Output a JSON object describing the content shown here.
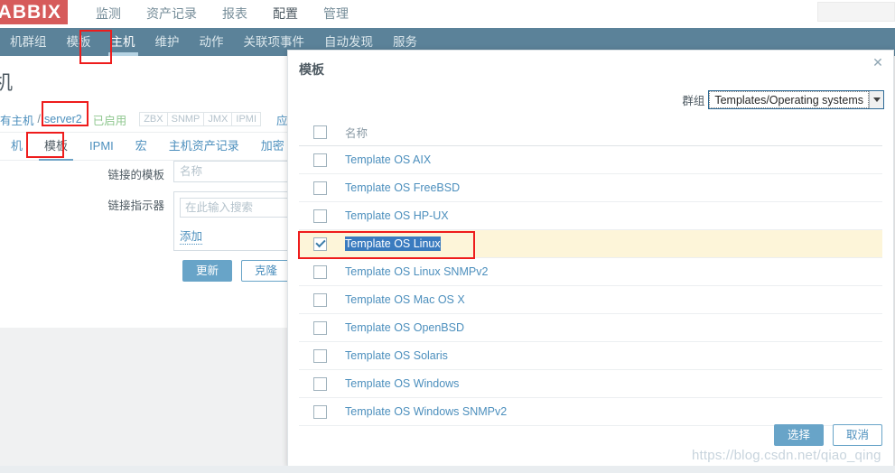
{
  "app": {
    "logo_text": "ABBIX",
    "main_menu": [
      {
        "label": "监测",
        "active": false
      },
      {
        "label": "资产记录",
        "active": false
      },
      {
        "label": "报表",
        "active": false
      },
      {
        "label": "配置",
        "active": true
      },
      {
        "label": "管理",
        "active": false
      }
    ],
    "sub_menu": [
      {
        "label": "机群组",
        "active": false
      },
      {
        "label": "模板",
        "active": false
      },
      {
        "label": "主机",
        "active": true
      },
      {
        "label": "维护",
        "active": false
      },
      {
        "label": "动作",
        "active": false
      },
      {
        "label": "关联项事件",
        "active": false
      },
      {
        "label": "自动发现",
        "active": false
      },
      {
        "label": "服务",
        "active": false
      }
    ]
  },
  "page": {
    "title": "机",
    "breadcrumb": {
      "root": "有主机",
      "separator": "/",
      "current": "server2"
    },
    "status": "已启用",
    "interface_tags": [
      "ZBX",
      "SNMP",
      "JMX",
      "IPMI"
    ],
    "apply_link": "应月",
    "tabs": [
      {
        "label": "机",
        "active": false
      },
      {
        "label": "模板",
        "active": true
      },
      {
        "label": "IPMI",
        "active": false
      },
      {
        "label": "宏",
        "active": false
      },
      {
        "label": "主机资产记录",
        "active": false
      },
      {
        "label": "加密",
        "active": false
      }
    ],
    "form": {
      "linked_templates_label": "链接的模板",
      "linked_templates_placeholder": "名称",
      "link_indicator_label": "链接指示器",
      "link_indicator_placeholder": "在此输入搜索",
      "add_link": "添加",
      "buttons": [
        {
          "label": "更新",
          "style": "primary"
        },
        {
          "label": "克隆",
          "style": "ghost"
        }
      ]
    }
  },
  "modal": {
    "title": "模板",
    "close_icon": "close-icon",
    "group_label": "群组",
    "group_value": "Templates/Operating systems",
    "column_header": "名称",
    "rows": [
      {
        "name": "Template OS AIX",
        "checked": false,
        "selected": false
      },
      {
        "name": "Template OS FreeBSD",
        "checked": false,
        "selected": false
      },
      {
        "name": "Template OS HP-UX",
        "checked": false,
        "selected": false
      },
      {
        "name": "Template OS Linux",
        "checked": true,
        "selected": true
      },
      {
        "name": "Template OS Linux SNMPv2",
        "checked": false,
        "selected": false
      },
      {
        "name": "Template OS Mac OS X",
        "checked": false,
        "selected": false
      },
      {
        "name": "Template OS OpenBSD",
        "checked": false,
        "selected": false
      },
      {
        "name": "Template OS Solaris",
        "checked": false,
        "selected": false
      },
      {
        "name": "Template OS Windows",
        "checked": false,
        "selected": false
      },
      {
        "name": "Template OS Windows SNMPv2",
        "checked": false,
        "selected": false
      }
    ],
    "select_button": "选择",
    "cancel_button": "取消"
  },
  "watermark": "https://blog.csdn.net/qiao_qing",
  "colors": {
    "brand_red": "#d65b5b",
    "nav_blue": "#5b8299",
    "link_blue": "#4c8fbd",
    "primary_button": "#68a4c8",
    "selected_row": "#fdf5d9",
    "annotation_red": "#ee1c1c",
    "text_selection": "#3a7bbf"
  }
}
